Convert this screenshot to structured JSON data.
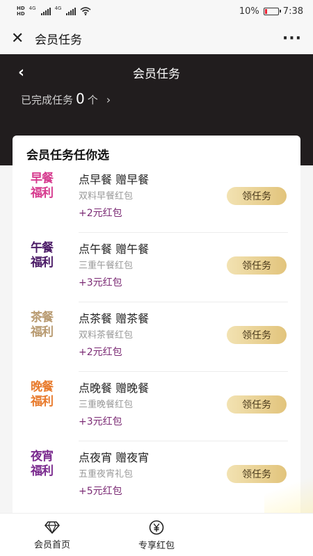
{
  "statusbar": {
    "hd1": "HD",
    "hd2": "HD",
    "net1": "4G",
    "net2": "4G",
    "battery": "10%",
    "time": "7:38"
  },
  "webview": {
    "title": "会员任务"
  },
  "hero": {
    "title": "会员任务",
    "done_label": "已完成任务",
    "done_count": "0",
    "done_unit": "个"
  },
  "card": {
    "title": "会员任务任你选",
    "tasks": [
      {
        "badge_line1": "早餐",
        "badge_line2": "福利",
        "badge_color": "#d63a8e",
        "name": "点早餐 赠早餐",
        "sub": "双料早餐红包",
        "reward": "+2元红包",
        "button": "领任务"
      },
      {
        "badge_line1": "午餐",
        "badge_line2": "福利",
        "badge_color": "#4a1a66",
        "name": "点午餐 赠午餐",
        "sub": "三重午餐红包",
        "reward": "+3元红包",
        "button": "领任务"
      },
      {
        "badge_line1": "茶餐",
        "badge_line2": "福利",
        "badge_color": "#b89a70",
        "name": "点茶餐 赠茶餐",
        "sub": "双料茶餐红包",
        "reward": "+2元红包",
        "button": "领任务"
      },
      {
        "badge_line1": "晚餐",
        "badge_line2": "福利",
        "badge_color": "#e87a2c",
        "name": "点晚餐 赠晚餐",
        "sub": "三重晚餐红包",
        "reward": "+3元红包",
        "button": "领任务"
      },
      {
        "badge_line1": "夜宵",
        "badge_line2": "福利",
        "badge_color": "#7a2a8e",
        "name": "点夜宵 赠夜宵",
        "sub": "五重夜宵礼包",
        "reward": "+5元红包",
        "button": "领任务"
      }
    ]
  },
  "tabbar": {
    "tabs": [
      {
        "label": "会员首页",
        "icon": "diamond-icon"
      },
      {
        "label": "专享红包",
        "icon": "yen-coin-icon"
      }
    ]
  }
}
